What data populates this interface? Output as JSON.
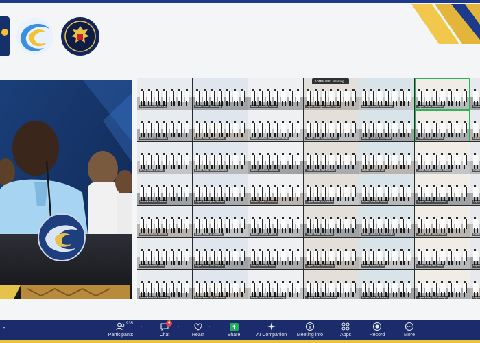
{
  "window": {
    "title": ""
  },
  "caption": {
    "text": "ADMIN APEL is talking..."
  },
  "logos": {
    "left": "agency-logo",
    "swirl": "program-logo",
    "seal": "national-emblem"
  },
  "speaker": {
    "description_icon": "speaker-video"
  },
  "grid_tiles": [
    {
      "label": "Lapas Kelas IIA Sorong"
    },
    {
      "label": "Rutan Kelas I Bandung"
    },
    {
      "label": "Lapas Kelas IIA Ternate"
    },
    {
      "label": "Lapas Wonogiri - Jawa Tengah"
    },
    {
      "label": "Lapas Kelas IIB Bulukumba"
    },
    {
      "label": "Lapas Kelas IIA Bekasi"
    },
    {
      "label": "Rutan Kelas IIB"
    },
    {
      "label": "Lapas Kelas III Kotabaru"
    },
    {
      "label": "Lapas Kelas IIA Pemalang"
    },
    {
      "label": "Lapas Kelas III Padangsidimpuan"
    },
    {
      "label": "Bapas Kelas I Jakarta Timur"
    },
    {
      "label": "Lapas Kelas IIB Sumbawa"
    },
    {
      "label": "Rutan Kelas IIB Manna"
    },
    {
      "label": "Lapas Narkotika"
    },
    {
      "label": "LPKA Kelas II Medan"
    },
    {
      "label": "Lapas Kelas IIB Banyuwangi"
    },
    {
      "label": "Lapas Kelas IIA Kalianda"
    },
    {
      "label": "Rutan Kelas IIB Pasaman"
    },
    {
      "label": "Lapas Kelas III Tual"
    },
    {
      "label": "Lapas Kelas IIB Lubuk Pakam"
    },
    {
      "label": "Rutan Kelas IIB Kayuagung"
    },
    {
      "label": "Lapas Kelas IIB Sleman"
    },
    {
      "label": "Lapas Perempuan Medan"
    },
    {
      "label": "Rutan Kelas I Makassar"
    },
    {
      "label": "Lapas Kelas IIA Jember"
    },
    {
      "label": "Rutan Kelas IIB Wates"
    },
    {
      "label": "Bapas Kelas II Manokwari"
    },
    {
      "label": "Lapas Kelas I Madiun"
    },
    {
      "label": "Lapas Kelas IIB Tanjung"
    },
    {
      "label": "Lapas Kelas III Kalabahi"
    },
    {
      "label": "Lapas Kelas IIA Sampit"
    },
    {
      "label": "Rutan Kelas IIB Sabang"
    },
    {
      "label": "Lapas Kelas IIB Muara Enim"
    },
    {
      "label": "Lapas Kelas IIA Kuningan"
    },
    {
      "label": "Rutan Kelas IIB Slawi"
    },
    {
      "label": "Lapas Kelas IIB Lahat"
    },
    {
      "label": "Lapas Kelas IIA Parepare"
    },
    {
      "label": "Rutan Kelas IIB Solok"
    },
    {
      "label": "Lapas Kelas I Semarang"
    },
    {
      "label": "Lapas Kelas IIB Pati"
    },
    {
      "label": "Rutan Kelas IIB Painan"
    },
    {
      "label": "Lapas Kelas IIA Gorontalo"
    },
    {
      "label": "Lapas Kelas IIB Bantaeng"
    },
    {
      "label": "Rutan Kelas IIB Jeneponto"
    },
    {
      "label": "Lapas Kelas III Rangkasbitung"
    },
    {
      "label": "Lapas Kelas IIA Samarinda"
    },
    {
      "label": "Rutan Kelas IIB Batang"
    },
    {
      "label": "Lapas Kelas IIB Sukoharjo"
    },
    {
      "label": "Lapas Kelas IIA Watampone"
    },
    {
      "label": "Rutan Kelas IIB Sinjai"
    }
  ],
  "toolbar": {
    "participants": {
      "label": "Participants",
      "count": "935"
    },
    "chat": {
      "label": "Chat",
      "badge": "4"
    },
    "react": {
      "label": "React"
    },
    "share": {
      "label": "Share"
    },
    "ai_companion": {
      "label": "AI Companion"
    },
    "meeting_info": {
      "label": "Meeting info"
    },
    "apps": {
      "label": "Apps"
    },
    "record": {
      "label": "Record"
    },
    "more": {
      "label": "More"
    }
  },
  "colors": {
    "toolbar_bg": "#1c2b6b",
    "accent_yellow": "#e7c53a",
    "accent_blue": "#1e3a8a",
    "share_green": "#1fae5a",
    "badge_red": "#e24444"
  }
}
